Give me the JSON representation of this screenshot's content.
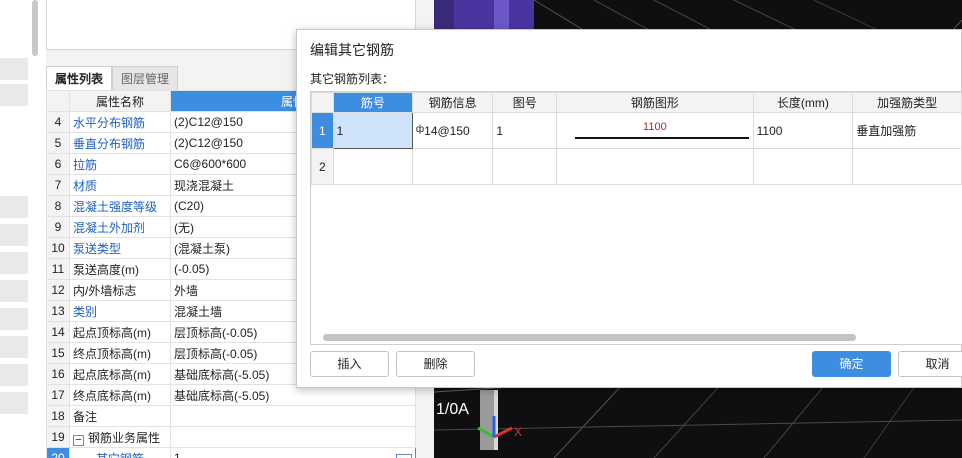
{
  "property_panel": {
    "tabs": [
      {
        "label": "属性列表",
        "active": true
      },
      {
        "label": "图层管理",
        "active": false
      }
    ],
    "header": {
      "name": "属性名称",
      "value": "属性"
    },
    "rows": [
      {
        "no": "4",
        "name": "水平分布钢筋",
        "value": "(2)C12@150",
        "blue": true
      },
      {
        "no": "5",
        "name": "垂直分布钢筋",
        "value": "(2)C12@150",
        "blue": true
      },
      {
        "no": "6",
        "name": "拉筋",
        "value": "C6@600*600",
        "blue": true
      },
      {
        "no": "7",
        "name": "材质",
        "value": "现浇混凝土",
        "blue": true
      },
      {
        "no": "8",
        "name": "混凝土强度等级",
        "value": "(C20)",
        "blue": true
      },
      {
        "no": "9",
        "name": "混凝土外加剂",
        "value": "(无)",
        "blue": true
      },
      {
        "no": "10",
        "name": "泵送类型",
        "value": "(混凝土泵)",
        "blue": true
      },
      {
        "no": "11",
        "name": "泵送高度(m)",
        "value": "(-0.05)",
        "blue": false
      },
      {
        "no": "12",
        "name": "内/外墙标志",
        "value": "外墙",
        "blue": false
      },
      {
        "no": "13",
        "name": "类别",
        "value": "混凝土墙",
        "blue": true
      },
      {
        "no": "14",
        "name": "起点顶标高(m)",
        "value": "层顶标高(-0.05)",
        "blue": false
      },
      {
        "no": "15",
        "name": "终点顶标高(m)",
        "value": "层顶标高(-0.05)",
        "blue": false
      },
      {
        "no": "16",
        "name": "起点底标高(m)",
        "value": "基础底标高(-5.05)",
        "blue": false
      },
      {
        "no": "17",
        "name": "终点底标高(m)",
        "value": "基础底标高(-5.05)",
        "blue": false
      },
      {
        "no": "18",
        "name": "备注",
        "value": "",
        "blue": false
      },
      {
        "no": "19",
        "name": "钢筋业务属性",
        "value": "",
        "blue": false,
        "expander": "−"
      },
      {
        "no": "20",
        "name": "其它钢筋",
        "value": "1",
        "blue": true,
        "selected": true
      }
    ]
  },
  "viewport": {
    "axis_label": "1/0A",
    "axis_x_label": "X"
  },
  "dialog": {
    "title": "编辑其它钢筋",
    "list_label": "其它钢筋列表：",
    "columns": [
      "筋号",
      "钢筋信息",
      "图号",
      "钢筋图形",
      "长度(mm)",
      "加强筋类型"
    ],
    "rows": [
      {
        "row_no": "1",
        "bar_no": "1",
        "bar_info": "14@150",
        "bar_info_symbol": "ф",
        "figure_no": "1",
        "shape_length_label": "1100",
        "length": "1100",
        "reinforce_type": "垂直加强筋"
      },
      {
        "row_no": "2",
        "bar_no": "",
        "bar_info": "",
        "bar_info_symbol": "",
        "figure_no": "",
        "shape_length_label": "",
        "length": "",
        "reinforce_type": ""
      }
    ],
    "buttons": {
      "insert": "插入",
      "delete": "删除",
      "ok": "确定",
      "cancel": "取消"
    }
  },
  "colors": {
    "accent": "#3d8ee0",
    "link_blue": "#1f5fc2",
    "shape_label_red": "#c02020"
  }
}
